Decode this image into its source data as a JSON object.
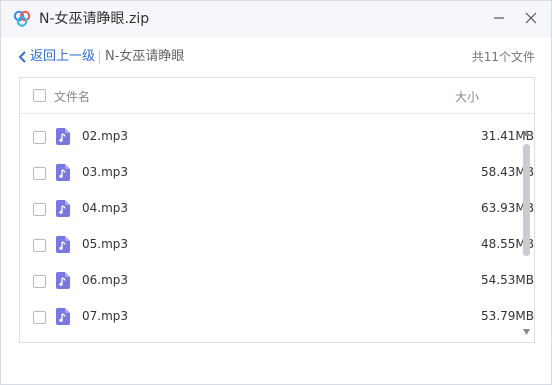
{
  "window": {
    "title": "N-女巫请睁眼.zip",
    "minimize_icon": "minimize-icon",
    "close_icon": "close-icon"
  },
  "nav": {
    "back_label": "返回上一级",
    "current_folder": "N-女巫请睁眼",
    "file_count": "共11个文件"
  },
  "list": {
    "header_name": "文件名",
    "header_size": "大小",
    "files": [
      {
        "name": "02.mp3",
        "size": "31.41MB"
      },
      {
        "name": "03.mp3",
        "size": "58.43MB"
      },
      {
        "name": "04.mp3",
        "size": "63.93MB"
      },
      {
        "name": "05.mp3",
        "size": "48.55MB"
      },
      {
        "name": "06.mp3",
        "size": "54.53MB"
      },
      {
        "name": "07.mp3",
        "size": "53.79MB"
      }
    ]
  },
  "colors": {
    "accent": "#2f6ed1",
    "audio_icon": "#7b77e0"
  },
  "icons": {
    "app": "baidu-netdisk-cloud-icon",
    "back": "chevron-left-icon",
    "file": "audio-file-icon"
  }
}
